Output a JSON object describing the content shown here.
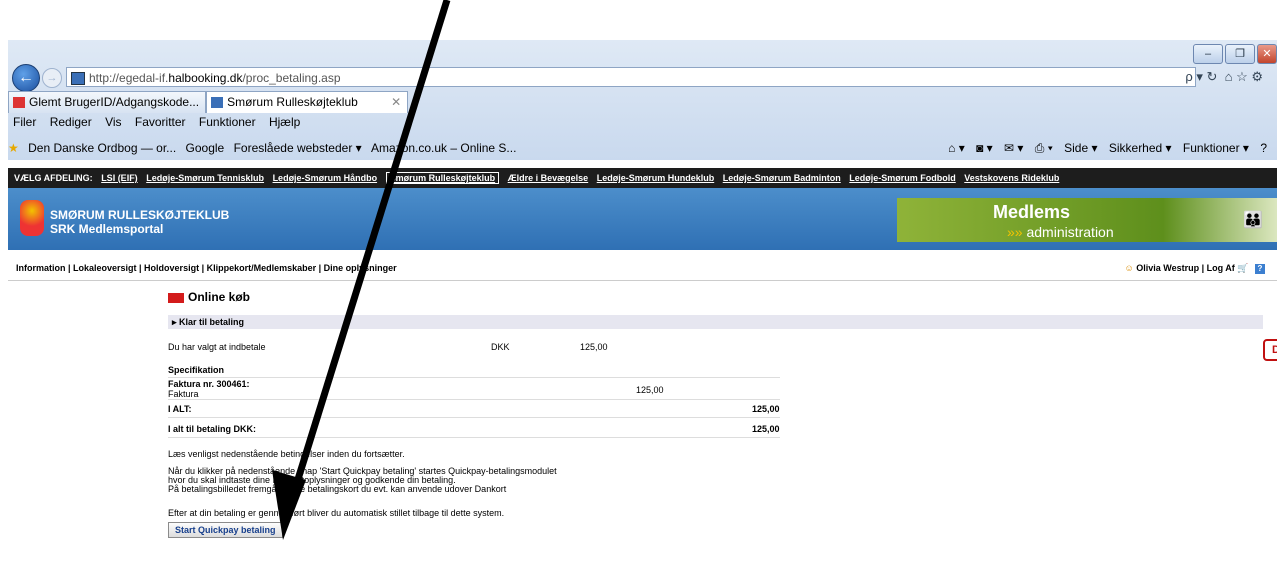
{
  "browser": {
    "url_prefix": "http://egedal-if.",
    "url_domain": "halbooking.dk",
    "url_path": "/proc_betaling.asp",
    "address_right": "ρ ▾ ↻",
    "tabs": [
      {
        "label": "Glemt BrugerID/Adgangskode..."
      },
      {
        "label": "Smørum Rulleskøjteklub",
        "close": "✕"
      }
    ],
    "menu": [
      "Filer",
      "Rediger",
      "Vis",
      "Favoritter",
      "Funktioner",
      "Hjælp"
    ],
    "favorites": [
      "Den Danske Ordbog — or...",
      "Google",
      "Foreslåede websteder ▾",
      "Amazon.co.uk – Online S..."
    ],
    "commands": [
      "Side ▾",
      "Sikkerhed ▾",
      "Funktioner ▾"
    ]
  },
  "page": {
    "dept_label": "VÆLG AFDELING:",
    "departments": [
      "LSI (EIF)",
      "Ledøje-Smørum Tennisklub",
      "Ledøje-Smørum Håndbo",
      "Smørum Rulleskøjteklub",
      "Ældre i Bevægelse",
      "Ledøje-Smørum Hundeklub",
      "Ledøje-Smørum Badminton",
      "Ledøje-Smørum Fodbold",
      "Vestskovens Rideklub"
    ],
    "club_name": "SMØRUM RULLESKØJTEKLUB",
    "portal_name": "SRK Medlemsportal",
    "logo_title": "Medlems",
    "logo_sub_arrows": "»»",
    "logo_sub": "administration",
    "nav_links": "Information | Lokaleoversigt | Holdoversigt | Klippekort/Medlemskaber | Dine oplysninger",
    "user_nav": "Olivia Westrup | Log Af",
    "heading": "Online køb",
    "step": "▸ Klar til betaling",
    "amount_label": "Du har valgt at indbetale",
    "currency": "DKK",
    "amount": "125,00",
    "spec_title": "Specifikation",
    "invoice_no": "Faktura nr. 300461:",
    "invoice_type": "Faktura",
    "invoice_amount": "125,00",
    "total_label": "I ALT:",
    "total": "125,00",
    "total_dkk_label": "I alt til betaling DKK:",
    "total_dkk": "125,00",
    "text1": "Læs venligst nedenstående betingelser inden du fortsætter.",
    "text2": "Når du klikker på nedenstående knap 'Start Quickpay betaling' startes Quickpay-betalingsmodulet",
    "text3": "hvor du skal indtaste dine Dankortoplysninger og godkende din betaling.",
    "text4": "På betalingsbilledet fremgår hvilke betalingskort du evt. kan anvende udover Dankort",
    "text5": "Efter at din betaling er gennemført bliver du automatisk stillet tilbage til dette system.",
    "button": "Start Quickpay betaling",
    "dk_logo": "DK"
  }
}
